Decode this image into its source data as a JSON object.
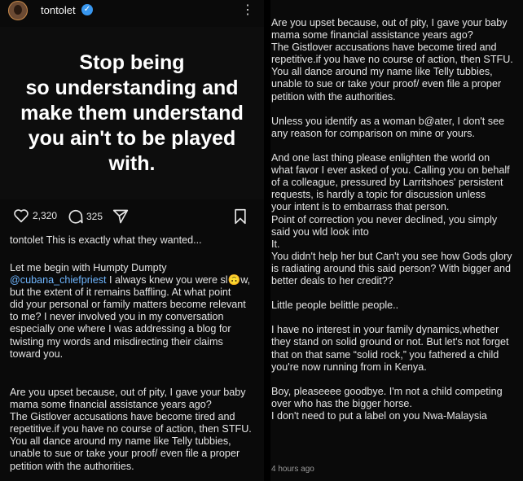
{
  "post": {
    "username": "tontolet",
    "image_text": "Stop being\nso understanding and\nmake them understand\nyou ain't to be played\nwith.",
    "likes": "2,320",
    "comments": "325",
    "caption_user": "tontolet",
    "caption_first": "This is exactly what they wanted...",
    "para1_before": "Let me begin with Humpty Dumpty\n",
    "mention": "@cubana_chiefpriest",
    "para1_after": " I always knew you were sl🙃w,\nbut the extent of it remains baffling. At what point\ndid your personal or family matters become relevant\nto me? I never involved you in my conversation\nespecially one where I was addressing a blog for\ntwisting my words and misdirecting their claims\ntoward you.",
    "left_tail": "Are you upset because, out of pity, I gave your baby\nmama some financial assistance years ago?\nThe Gistlover accusations have become tired and\nrepetitive.if you have no course of action, then STFU.\nYou all dance around my name like Telly tubbies,\nunable to sue or take your proof/ even file a proper\npetition with the authorities.",
    "right_text": "Are you upset because, out of pity, I gave your baby\nmama some financial assistance years ago?\nThe Gistlover accusations have become tired and\nrepetitive.if you have no course of action, then STFU.\nYou all dance around my name like Telly tubbies,\nunable to sue or take your proof/ even file a proper\npetition with the authorities.\n\nUnless you identify as a woman b@ater, I don't see\nany reason for comparison on mine or yours.\n\nAnd one last thing please enlighten the world on\nwhat favor I ever asked of you. Calling you on behalf\nof a colleague, pressured by Larritshoes' persistent\nrequests, is hardly a topic for discussion unless\nyour intent is to embarrass that person.\nPoint of correction you never declined, you simply\nsaid you wld look into\nIt.\nYou didn't help her but Can't you see how Gods glory\nis radiating around this said person? With bigger and\nbetter deals to her credit??\n\nLittle people belittle people..\n\nI have no interest in your family dynamics,whether\nthey stand on solid ground or not. But let's not forget\nthat on that same “solid rock,” you fathered a child\nyou're now running from in Kenya.\n\nBoy, pleaseeee goodbye. I'm not a child competing\nover who has the bigger horse.\nI don't need to put a label on you Nwa-Malaysia",
    "timestamp": "4 hours ago"
  },
  "colors": {
    "verified": "#3897f0",
    "mention": "#6fb6ff",
    "background": "#0a0a0a"
  },
  "icons": [
    "verified-badge-icon",
    "more-options-icon",
    "heart-icon",
    "comment-icon",
    "share-icon",
    "bookmark-icon"
  ]
}
